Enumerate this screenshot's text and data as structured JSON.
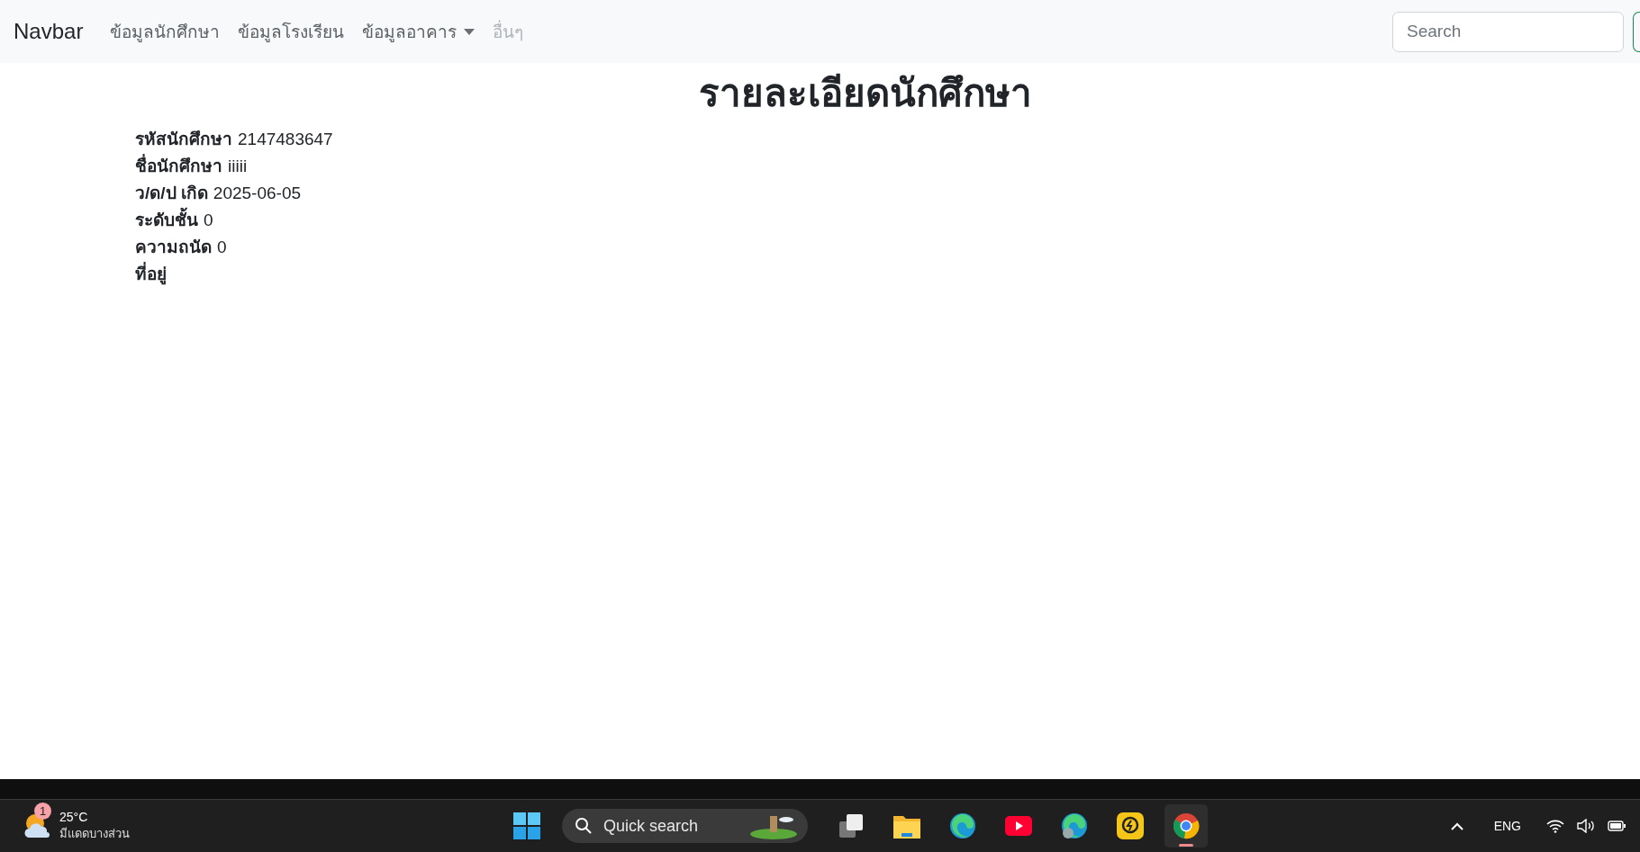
{
  "navbar": {
    "brand": "Navbar",
    "links": [
      {
        "label": "ข้อมูลนักศึกษา",
        "kind": "link",
        "disabled": false
      },
      {
        "label": "ข้อมูลโรงเรียน",
        "kind": "link",
        "disabled": false
      },
      {
        "label": "ข้อมูลอาคาร",
        "kind": "dropdown",
        "disabled": false
      },
      {
        "label": "อื่นๆ",
        "kind": "link",
        "disabled": true
      }
    ],
    "search": {
      "placeholder": "Search"
    }
  },
  "page": {
    "title": "รายละเอียดนักศึกษา",
    "fields": [
      {
        "label": "รหัสนักศึกษา",
        "value": "2147483647"
      },
      {
        "label": "ชื่อนักศึกษา",
        "value": "iiiii"
      },
      {
        "label": "ว/ด/ป เกิด",
        "value": "2025-06-05"
      },
      {
        "label": "ระดับชั้น",
        "value": "0"
      },
      {
        "label": "ความถนัด",
        "value": "0"
      },
      {
        "label": "ที่อยู่"
      }
    ]
  },
  "taskbar": {
    "weather": {
      "badge": "1",
      "temperature": "25°C",
      "condition": "มีแดดบางส่วน"
    },
    "search": {
      "placeholder": "Quick search"
    },
    "apps": [
      {
        "kind": "taskview",
        "active": false
      },
      {
        "kind": "folder",
        "active": false
      },
      {
        "kind": "edge",
        "active": false
      },
      {
        "kind": "youtube",
        "active": false
      },
      {
        "kind": "edge-profile",
        "active": false
      },
      {
        "kind": "lightning",
        "active": false
      },
      {
        "kind": "chrome",
        "active": true
      }
    ],
    "language": "ENG"
  }
}
